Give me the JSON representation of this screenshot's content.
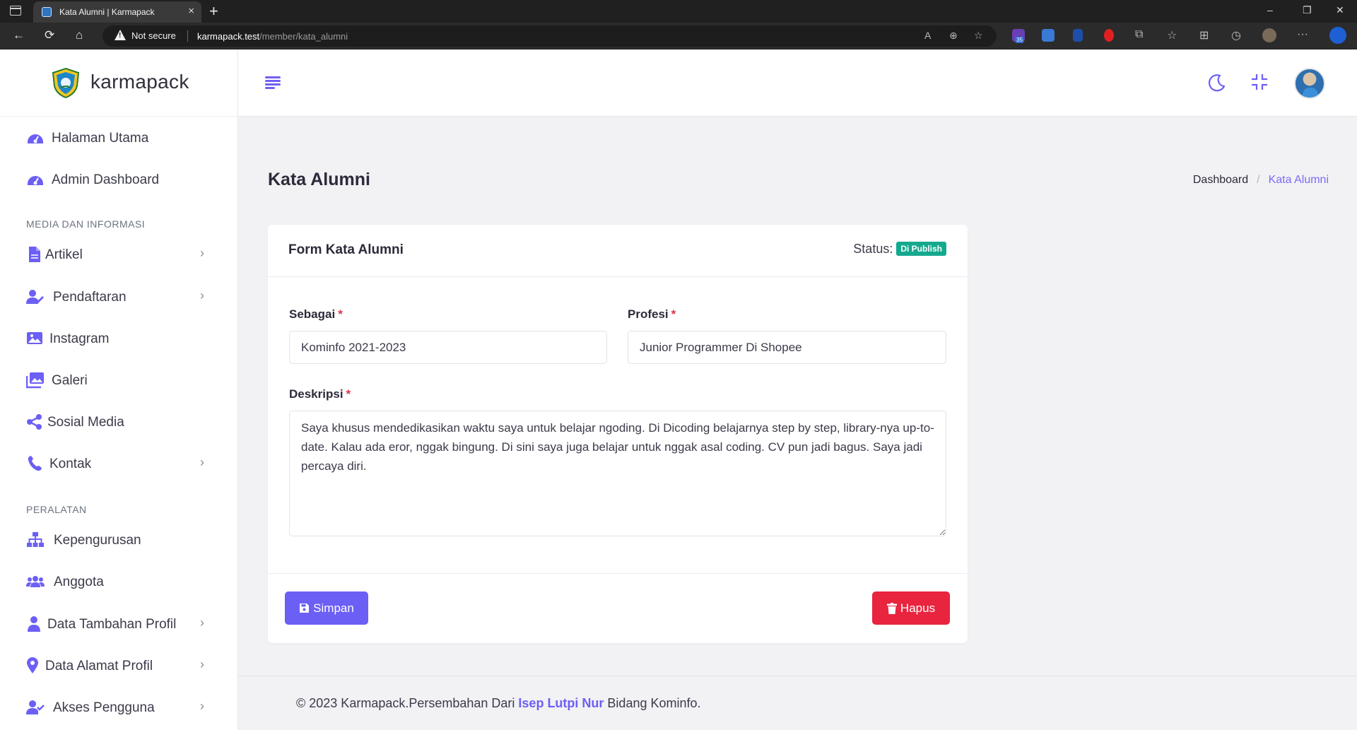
{
  "browser": {
    "tab_title": "Kata Alumni | Karmapack",
    "tab_close": "×",
    "new_tab": "+",
    "security_label": "Not secure",
    "url_host": "karmapack.test",
    "url_path": "/member/kata_alumni",
    "extension_badge": "35",
    "window_controls": {
      "minimize": "–",
      "restore": "❐",
      "close": "✕"
    },
    "nav": {
      "back": "←",
      "reload": "⟳",
      "home": "⌂"
    }
  },
  "brand": {
    "name": "karmapack",
    "logo_icon": "shield-logo"
  },
  "sidebar": {
    "items_top": [
      {
        "label": "Halaman Utama",
        "icon": "dashboard-gauge-icon"
      },
      {
        "label": "Admin Dashboard",
        "icon": "dashboard-gauge-icon"
      }
    ],
    "section_media": "MEDIA DAN INFORMASI",
    "items_media": [
      {
        "label": "Artikel",
        "icon": "file-icon",
        "has_children": true
      },
      {
        "label": "Pendaftaran",
        "icon": "user-edit-icon",
        "has_children": true
      },
      {
        "label": "Instagram",
        "icon": "image-icon",
        "has_children": false
      },
      {
        "label": "Galeri",
        "icon": "images-icon",
        "has_children": false
      },
      {
        "label": "Sosial Media",
        "icon": "share-icon",
        "has_children": false
      },
      {
        "label": "Kontak",
        "icon": "phone-icon",
        "has_children": true
      }
    ],
    "section_tools": "PERALATAN",
    "items_tools": [
      {
        "label": "Kepengurusan",
        "icon": "sitemap-icon",
        "has_children": false
      },
      {
        "label": "Anggota",
        "icon": "users-icon",
        "has_children": false
      },
      {
        "label": "Data Tambahan Profil",
        "icon": "user-icon",
        "has_children": true
      },
      {
        "label": "Data Alamat Profil",
        "icon": "map-pin-icon",
        "has_children": true
      },
      {
        "label": "Akses Pengguna",
        "icon": "user-check-icon",
        "has_children": true
      }
    ],
    "chevron": "›"
  },
  "header": {
    "menu_icon": "hamburger-icon",
    "theme_icon": "moon-icon",
    "fullscreen_icon": "compress-icon"
  },
  "page": {
    "title": "Kata Alumni",
    "breadcrumb": {
      "home": "Dashboard",
      "separator": "/",
      "current": "Kata Alumni"
    }
  },
  "form": {
    "title": "Form Kata Alumni",
    "status_label": "Status:",
    "status_value": "Di Publish",
    "required_mark": "*",
    "sebagai": {
      "label": "Sebagai",
      "value": "Kominfo 2021-2023"
    },
    "profesi": {
      "label": "Profesi",
      "value": "Junior Programmer Di Shopee"
    },
    "deskripsi": {
      "label": "Deskripsi",
      "value": "Saya khusus mendedikasikan waktu saya untuk belajar ngoding. Di Dicoding belajarnya step by step, library-nya up-to-date. Kalau ada eror, nggak bingung. Di sini saya juga belajar untuk nggak asal coding. CV pun jadi bagus. Saya jadi percaya diri."
    },
    "save_label": "Simpan",
    "delete_label": "Hapus"
  },
  "footer": {
    "prefix": "© 2023 Karmapack.Persembahan Dari ",
    "author": "Isep Lutpi Nur",
    "suffix": " Bidang Kominfo."
  },
  "colors": {
    "accent": "#6c5ff5",
    "danger": "#e8243f",
    "success": "#14a98e",
    "bg": "#f2f1f4"
  }
}
